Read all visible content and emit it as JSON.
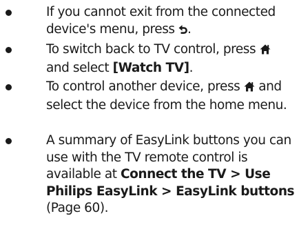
{
  "bullets": [
    {
      "before": "If you cannot exit from the connected device's menu, press",
      "icon": "back-icon",
      "after": "."
    },
    {
      "before": "To switch back to TV control, press",
      "icon": "home-icon",
      "middle": "and select",
      "bold": "[Watch TV]",
      "after": "."
    },
    {
      "before": "To control another device, press",
      "icon": "home-icon",
      "after": "and select the device from the home menu."
    },
    {
      "before": "A summary of EasyLink buttons you can use with the TV remote control is available at",
      "bold": "Connect the TV > Use Philips EasyLink > EasyLink buttons",
      "after": "(Page 60)."
    }
  ]
}
